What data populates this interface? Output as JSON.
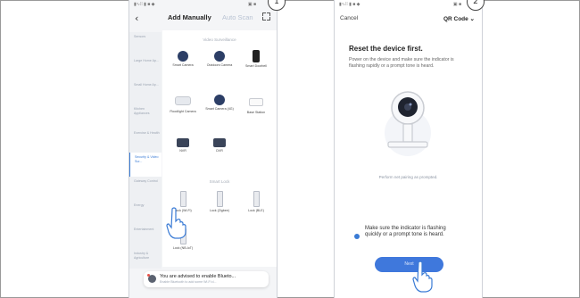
{
  "steps": [
    "1",
    "2"
  ],
  "left_phone": {
    "status_bar": {
      "left": "▮∿⁞⁞ ▮ ■ ◆",
      "right": "▣ ■"
    },
    "header": {
      "back_icon": "chevron-left",
      "tab_active": "Add Manually",
      "tab_inactive": "Auto Scan",
      "scan_icon": "scan-frame"
    },
    "sidebar": [
      {
        "label": "Sensors",
        "active": false
      },
      {
        "label": "Large Home Ap...",
        "active": false
      },
      {
        "label": "Small Home Ap...",
        "active": false
      },
      {
        "label": "Kitchen Appliances",
        "active": false
      },
      {
        "label": "Exercise & Health",
        "active": false
      },
      {
        "label": "Security & Video Sur...",
        "active": true
      },
      {
        "label": "Gateway Control",
        "active": false
      },
      {
        "label": "Energy",
        "active": false
      },
      {
        "label": "Entertainment",
        "active": false
      },
      {
        "label": "Industry & Agriculture",
        "active": false
      }
    ],
    "sections": {
      "video_surveillance": "Video Surveillance",
      "smart_lock": "Smart Lock"
    },
    "devices": [
      {
        "label": "Smart Camera",
        "icon": "camera"
      },
      {
        "label": "Outdoors Camera",
        "icon": "camera"
      },
      {
        "label": "Smart Doorbell",
        "icon": "doorbell"
      },
      {
        "label": "Floodlight Camera",
        "icon": "floodlight"
      },
      {
        "label": "Smart Camera (4G)",
        "icon": "camera"
      },
      {
        "label": "Base Station",
        "icon": "base-station"
      },
      {
        "label": "NVR",
        "icon": "nvr"
      },
      {
        "label": "DVR",
        "icon": "nvr"
      }
    ],
    "locks": [
      {
        "label": "Lock (Wi-Fi)"
      },
      {
        "label": "Lock (Zigbee)"
      },
      {
        "label": "Lock (BLE)"
      },
      {
        "label": "Lock (NB-IoT)"
      }
    ],
    "hint": {
      "title": "You are advised to enable Blueto...",
      "subtitle": "Enable Bluetooth to add some Wi-Fi d..."
    }
  },
  "right_phone": {
    "status_bar": {
      "left": "▮∿⁞⁞ ▮ ■ ◆",
      "right": "▣ ■"
    },
    "header": {
      "cancel": "Cancel",
      "qr": "QR Code ⌄"
    },
    "title": "Reset the device first.",
    "description": "Power on the device and make sure the indicator is flashing rapidly or a prompt tone is heard.",
    "link": "Perform net pairing as prompted.",
    "confirm_text": "Make sure the indicator is flashing quickly or a prompt tone is heard.",
    "next_button": "Next"
  },
  "colors": {
    "accent": "#3f78dc",
    "active_text": "#3a7bd5",
    "dark_device": "#2c3e66"
  }
}
